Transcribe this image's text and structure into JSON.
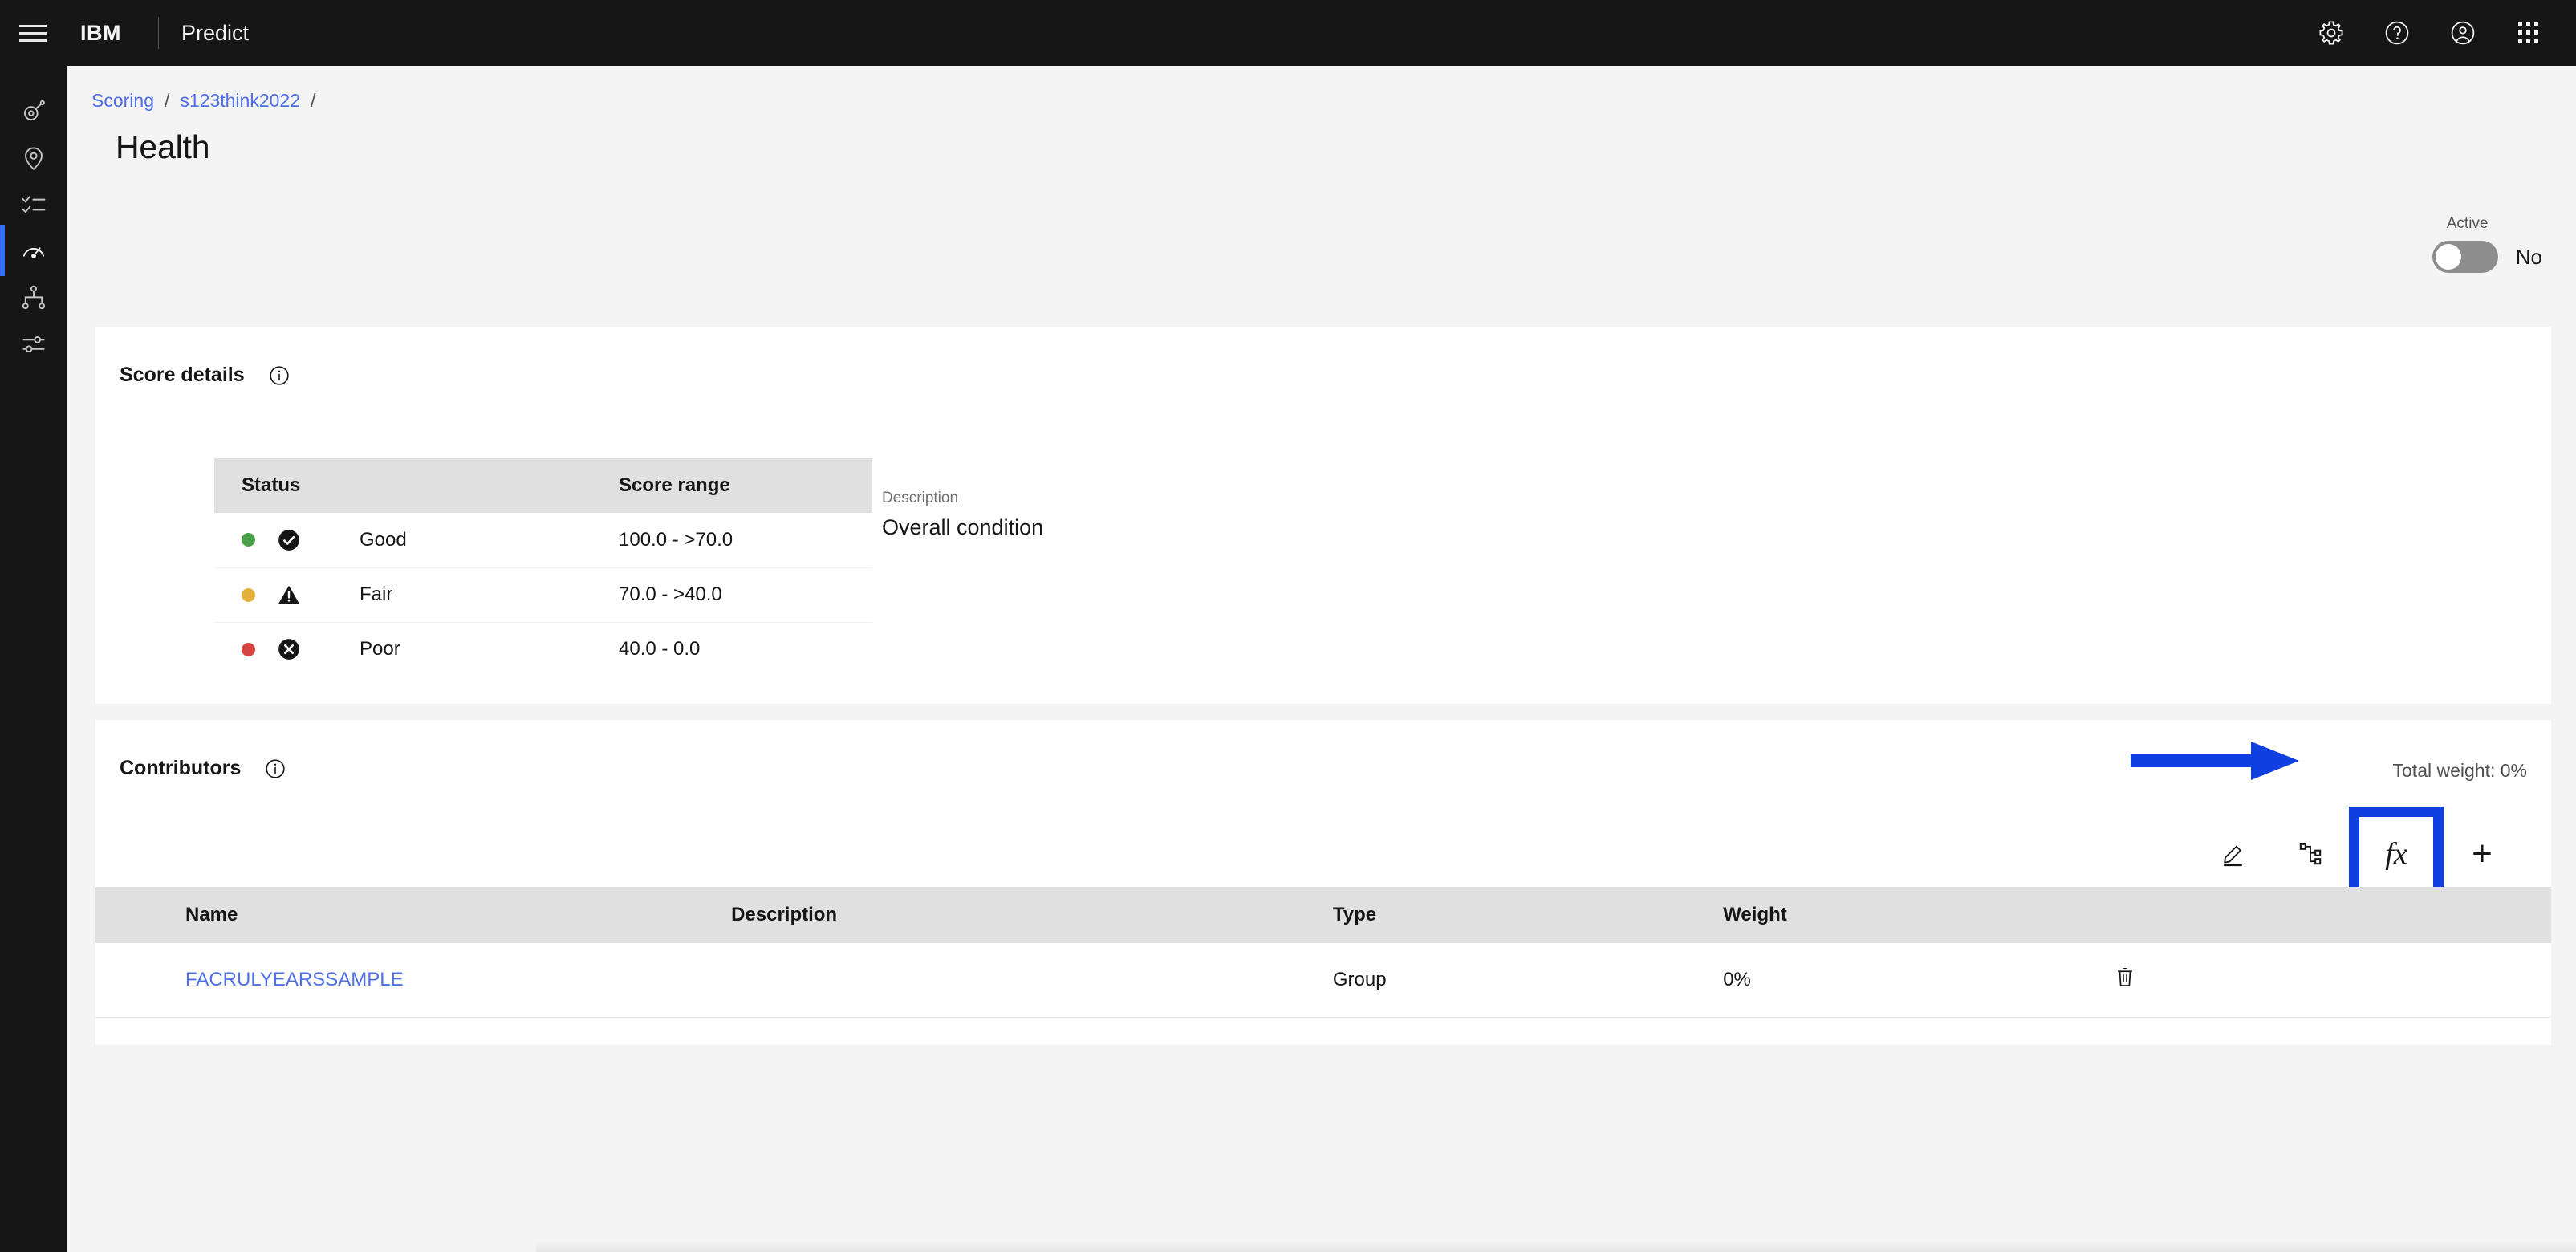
{
  "header": {
    "menu_icon": "hamburger-menu-icon",
    "brand": "IBM",
    "app_name": "Predict",
    "actions": [
      {
        "name": "settings-icon",
        "label": "Settings"
      },
      {
        "name": "help-icon",
        "label": "Help"
      },
      {
        "name": "user-avatar-icon",
        "label": "Profile"
      },
      {
        "name": "app-switcher-icon",
        "label": "App switcher"
      }
    ]
  },
  "sidebar": {
    "items": [
      {
        "name": "asset-icon",
        "active": false
      },
      {
        "name": "location-pin-icon",
        "active": false
      },
      {
        "name": "checklist-icon",
        "active": false
      },
      {
        "name": "gauge-icon",
        "active": true
      },
      {
        "name": "hierarchy-icon",
        "active": false
      },
      {
        "name": "sliders-icon",
        "active": false
      }
    ],
    "active_indicator_color": "#2f6ef3"
  },
  "breadcrumb": {
    "items": [
      "Scoring",
      "s123think2022"
    ],
    "separator": "/",
    "trailing_separator": "/",
    "link_color": "#4d6fe8"
  },
  "page": {
    "title": "Health"
  },
  "active_toggle": {
    "label": "Active",
    "value": "No",
    "state": "off"
  },
  "score_details": {
    "title": "Score details",
    "info_icon": "info-icon",
    "columns": [
      "Status",
      "Score range"
    ],
    "rows": [
      {
        "status_label": "Good",
        "score_range": "100.0 - >70.0",
        "dot_color": "#4aa04a",
        "icon": "check-filled-icon"
      },
      {
        "status_label": "Fair",
        "score_range": "70.0 - >40.0",
        "dot_color": "#e4b23c",
        "icon": "warning-filled-icon"
      },
      {
        "status_label": "Poor",
        "score_range": "40.0 - 0.0",
        "dot_color": "#d64541",
        "icon": "error-filled-icon"
      }
    ],
    "description_label": "Description",
    "description_value": "Overall condition"
  },
  "contributors": {
    "title": "Contributors",
    "info_icon": "info-icon",
    "total_weight_label": "Total weight: 0%",
    "toolbar": [
      {
        "name": "edit-icon",
        "label": "Edit",
        "highlighted": false
      },
      {
        "name": "group-icon",
        "label": "Group",
        "highlighted": false
      },
      {
        "name": "function-icon",
        "label": "fx",
        "highlighted": true
      },
      {
        "name": "add-icon",
        "label": "+",
        "highlighted": false
      }
    ],
    "columns": [
      "Name",
      "Description",
      "Type",
      "Weight"
    ],
    "rows": [
      {
        "expander": "chevron-down-icon",
        "name": "FACRULYEARSSAMPLE",
        "description": "",
        "type": "Group",
        "weight": "0%",
        "action": "delete-icon"
      }
    ]
  },
  "annotation": {
    "arrow_color": "#0f3fe0",
    "highlight_color": "#0f3fe0",
    "points_to": "function-icon"
  }
}
